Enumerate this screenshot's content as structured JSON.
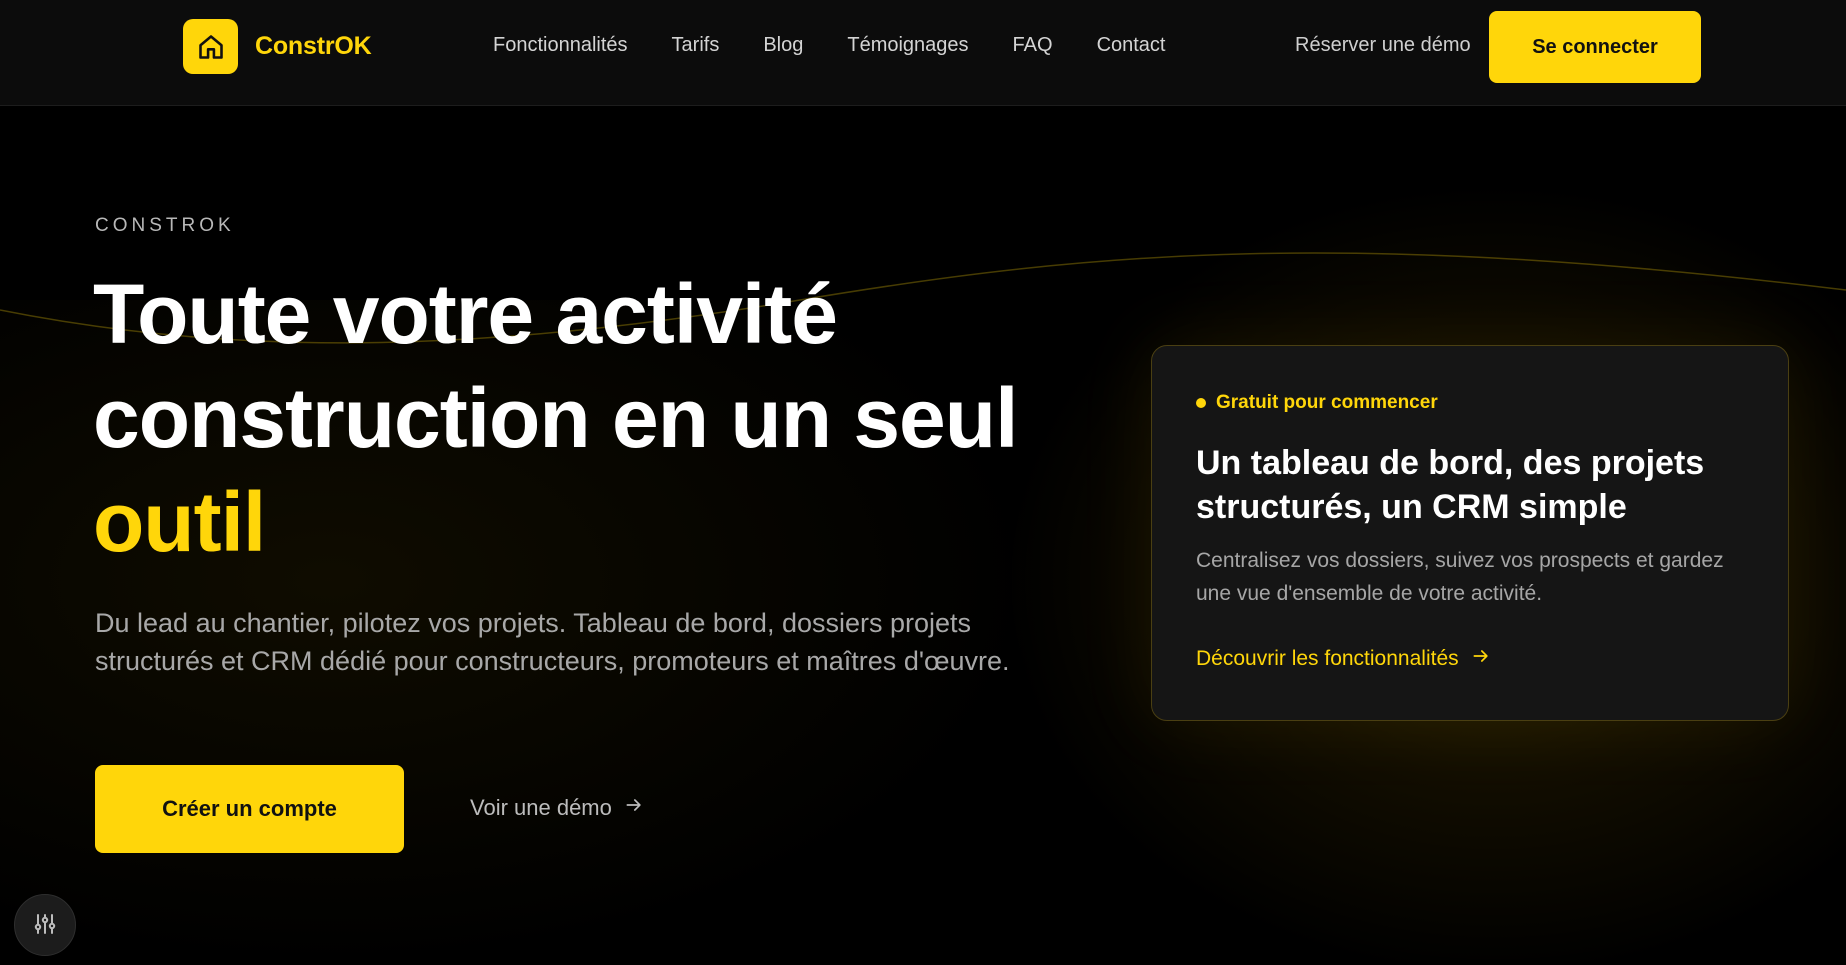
{
  "header": {
    "logo_text": "ConstrOK",
    "logo_icon": "home-icon",
    "nav": [
      {
        "label": "Fonctionnalités"
      },
      {
        "label": "Tarifs"
      },
      {
        "label": "Blog"
      },
      {
        "label": "Témoignages"
      },
      {
        "label": "FAQ"
      },
      {
        "label": "Contact"
      }
    ],
    "demo_link": "Réserver une démo",
    "login_button": "Se connecter"
  },
  "hero": {
    "eyebrow": "CONSTROK",
    "title_line1": "Toute votre activité",
    "title_line2": "construction en un seul",
    "title_accent": "outil",
    "description": "Du lead au chantier, pilotez vos projets. Tableau de bord, dossiers projets structurés et CRM dédié pour constructeurs, promoteurs et maîtres d'œuvre.",
    "primary_cta": "Créer un compte",
    "secondary_cta": "Voir une démo",
    "secondary_cta_icon": "arrow-right-icon"
  },
  "card": {
    "badge": "Gratuit pour commencer",
    "title": "Un tableau de bord, des projets structurés, un CRM simple",
    "description": "Centralisez vos dossiers, suivez vos prospects et gardez une vue d'ensemble de votre activité.",
    "link": "Découvrir les fonctionnalités",
    "link_icon": "arrow-right-icon"
  },
  "settings_fab_icon": "sliders-icon",
  "colors": {
    "accent": "#ffd60a",
    "background": "#000000",
    "header_bg": "#0c0c0c",
    "card_bg": "#151515"
  }
}
